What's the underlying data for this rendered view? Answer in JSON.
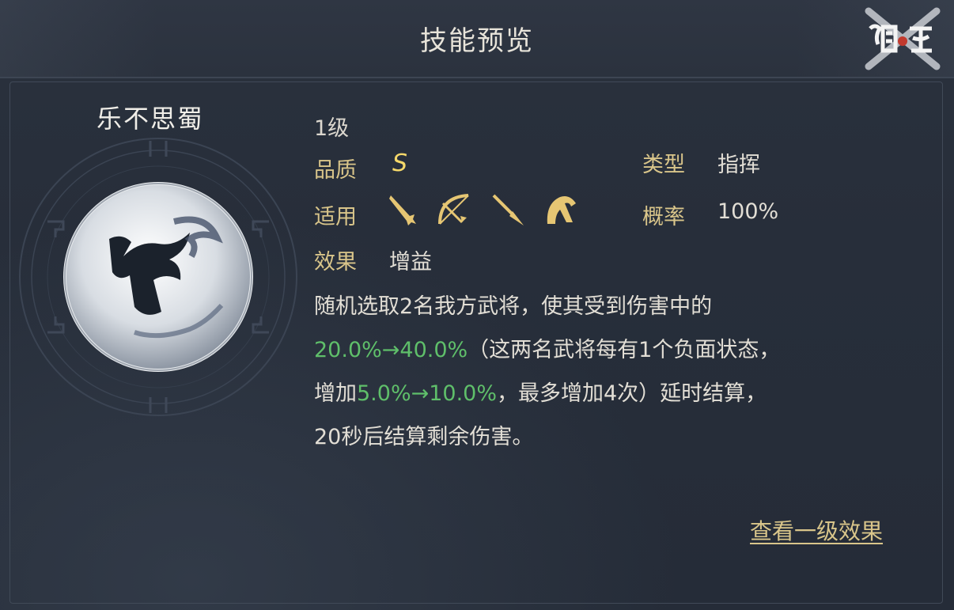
{
  "header": {
    "title": "技能预览"
  },
  "skill": {
    "name": "乐不思蜀",
    "level": "1级",
    "quality_label": "品质",
    "quality_value": "S",
    "type_label": "类型",
    "type_value": "指挥",
    "applicable_label": "适用",
    "applicable_icons": [
      "sword-icon",
      "bow-icon",
      "spear-icon",
      "horse-icon"
    ],
    "chance_label": "概率",
    "chance_value": "100%",
    "effect_label": "效果",
    "effect_value": "增益"
  },
  "description": {
    "line1": "随机选取2名我方武将，使其受到伤害中的",
    "line2_green": "20.0%→40.0%",
    "line2_rest": "（这两名武将每有1个负面状态，",
    "line3_prefix": "增加",
    "line3_green": "5.0%→10.0%",
    "line3_rest": "，最多增加4次）延时结算，",
    "line4": "20秒后结算剩余伤害。"
  },
  "footer": {
    "link_label": "查看一级效果"
  },
  "colors": {
    "gold": "#d9c58a",
    "green": "#5fbf6a",
    "panel": "#272e3a"
  }
}
